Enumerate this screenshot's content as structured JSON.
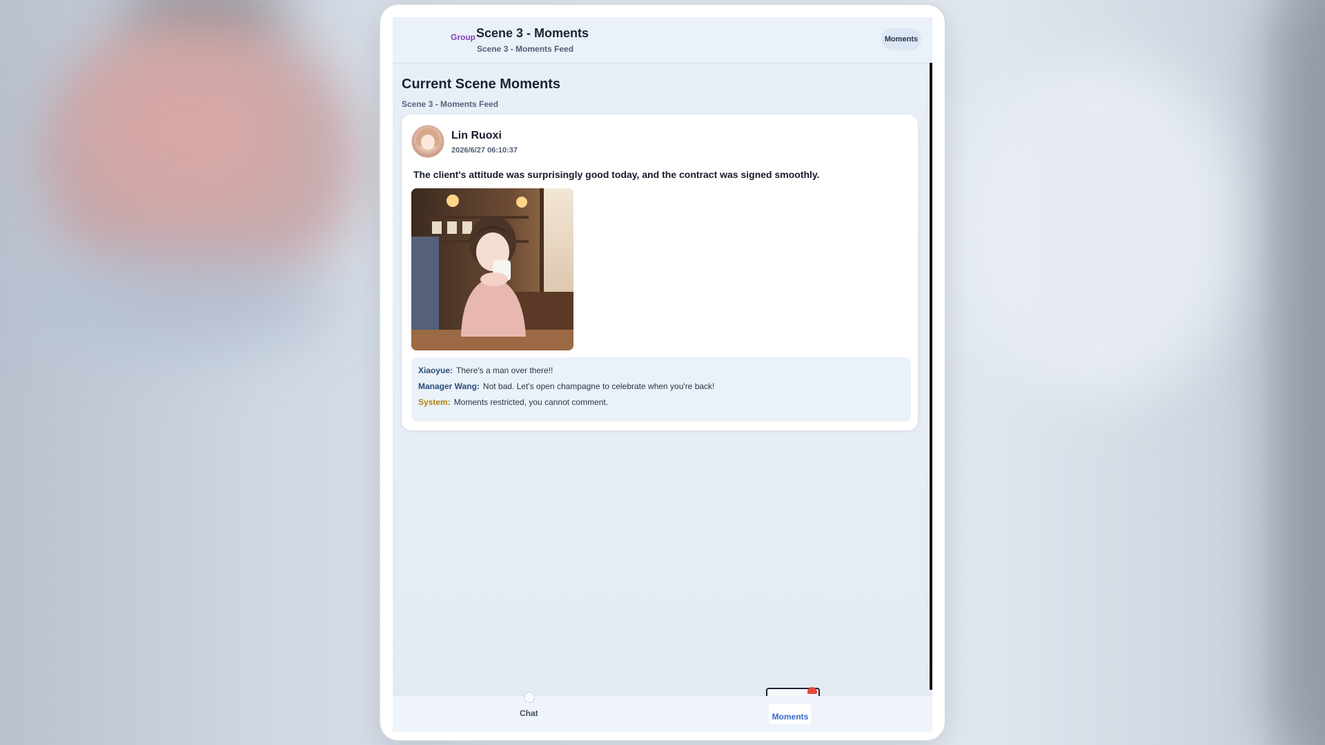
{
  "header": {
    "group_label": "Group",
    "title": "Scene 3 - Moments",
    "subtitle": "Scene 3 - Moments Feed",
    "moments_button": "Moments"
  },
  "section": {
    "title": "Current Scene Moments",
    "subtitle": "Scene 3 - Moments Feed"
  },
  "post": {
    "author": "Lin Ruoxi",
    "timestamp": "2026/6/27 06:10:37",
    "text": "The client's attitude was surprisingly good today, and the contract was signed smoothly.",
    "comments": [
      {
        "author": "Xiaoyue:",
        "text": "There's a man over there!!",
        "type": "user"
      },
      {
        "author": "Manager Wang:",
        "text": "Not bad. Let's open champagne to celebrate when you're back!",
        "type": "user"
      },
      {
        "author": "System:",
        "text": "Moments restricted, you cannot comment.",
        "type": "system"
      }
    ]
  },
  "nav": {
    "chat_label": "Chat",
    "moments_label": "Moments"
  },
  "colors": {
    "accent": "#3568c9",
    "group_label": "#7b3fb5",
    "system_label": "#b0820f",
    "badge": "#e8453c"
  }
}
